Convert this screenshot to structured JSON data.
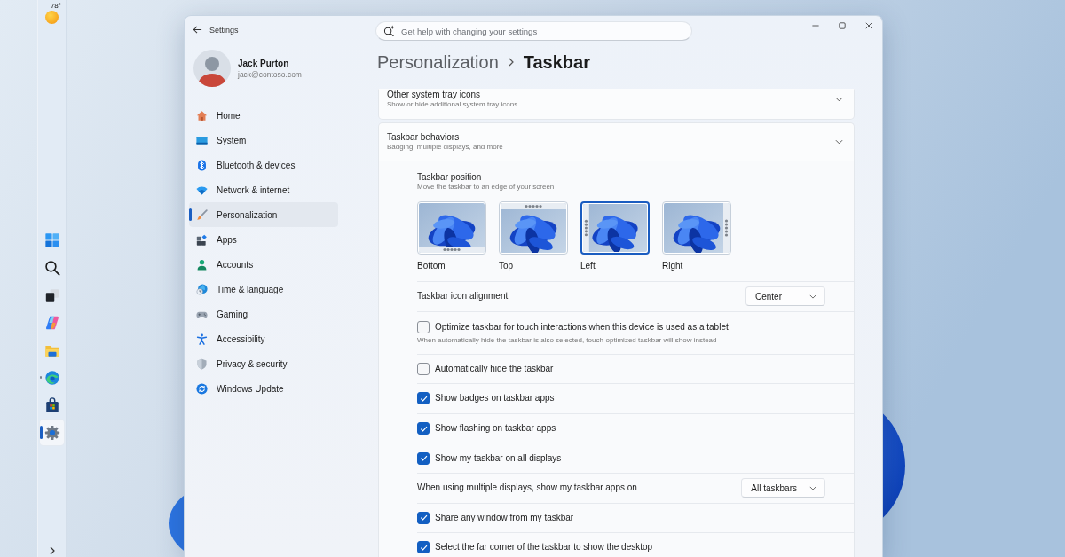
{
  "desktop": {
    "taskbar": {
      "weather": {
        "temperature": "78°"
      },
      "apps": [
        {
          "kind": "start",
          "selected": false,
          "running": false
        },
        {
          "kind": "search",
          "selected": false,
          "running": false
        },
        {
          "kind": "taskview",
          "selected": false,
          "running": false
        },
        {
          "kind": "copilot",
          "selected": false,
          "running": false
        },
        {
          "kind": "explorer",
          "selected": false,
          "running": false
        },
        {
          "kind": "edge",
          "selected": false,
          "running": true
        },
        {
          "kind": "store",
          "selected": false,
          "running": false
        },
        {
          "kind": "settings",
          "selected": true,
          "running": true
        }
      ]
    }
  },
  "window": {
    "title": "Settings",
    "search": {
      "placeholder": "Get help with changing your settings"
    }
  },
  "profile": {
    "name": "Jack Purton",
    "email": "jack@contoso.com"
  },
  "sidebar": {
    "items": [
      {
        "label": "Home",
        "kind": "home",
        "selected": false
      },
      {
        "label": "System",
        "kind": "system",
        "selected": false
      },
      {
        "label": "Bluetooth & devices",
        "kind": "bluetooth",
        "selected": false
      },
      {
        "label": "Network & internet",
        "kind": "network",
        "selected": false
      },
      {
        "label": "Personalization",
        "kind": "personalization",
        "selected": true
      },
      {
        "label": "Apps",
        "kind": "apps",
        "selected": false
      },
      {
        "label": "Accounts",
        "kind": "accounts",
        "selected": false
      },
      {
        "label": "Time & language",
        "kind": "time",
        "selected": false
      },
      {
        "label": "Gaming",
        "kind": "gaming",
        "selected": false
      },
      {
        "label": "Accessibility",
        "kind": "accessibility",
        "selected": false
      },
      {
        "label": "Privacy & security",
        "kind": "privacy",
        "selected": false
      },
      {
        "label": "Windows Update",
        "kind": "update",
        "selected": false
      }
    ]
  },
  "breadcrumb": [
    "Personalization",
    "Taskbar"
  ],
  "sections": [
    {
      "title": "Other system tray icons",
      "description": "Show or hide additional system tray icons",
      "expanded": false
    },
    {
      "title": "Taskbar behaviors",
      "description": "Badging, multiple displays, and more",
      "expanded": true,
      "position": {
        "title": "Taskbar position",
        "description": "Move the taskbar to an edge of your screen",
        "options": [
          {
            "label": "Bottom",
            "kind": "bottom",
            "selected": false
          },
          {
            "label": "Top",
            "kind": "top",
            "selected": false
          },
          {
            "label": "Left",
            "kind": "left",
            "selected": true
          },
          {
            "label": "Right",
            "kind": "right",
            "selected": false
          }
        ]
      },
      "settings": [
        {
          "kind": "dropdown",
          "label": "Taskbar icon alignment",
          "value": "Center"
        },
        {
          "kind": "checkbox",
          "label": "Optimize taskbar for touch interactions when this device is used as a tablet",
          "description": "When automatically hide the taskbar is also selected, touch-optimized taskbar will show instead",
          "checked": false
        },
        {
          "kind": "checkbox",
          "label": "Automatically hide the taskbar",
          "checked": false
        },
        {
          "kind": "checkbox",
          "label": "Show badges on taskbar apps",
          "checked": true
        },
        {
          "kind": "checkbox",
          "label": "Show flashing on taskbar apps",
          "checked": true
        },
        {
          "kind": "checkbox",
          "label": "Show my taskbar on all displays",
          "checked": true
        },
        {
          "kind": "dropdown",
          "label": "When using multiple displays, show my taskbar apps on",
          "value": "All taskbars"
        },
        {
          "kind": "checkbox",
          "label": "Share any window from my taskbar",
          "checked": true
        },
        {
          "kind": "checkbox",
          "label": "Select the far corner of the taskbar to show the desktop",
          "checked": true
        }
      ]
    }
  ]
}
